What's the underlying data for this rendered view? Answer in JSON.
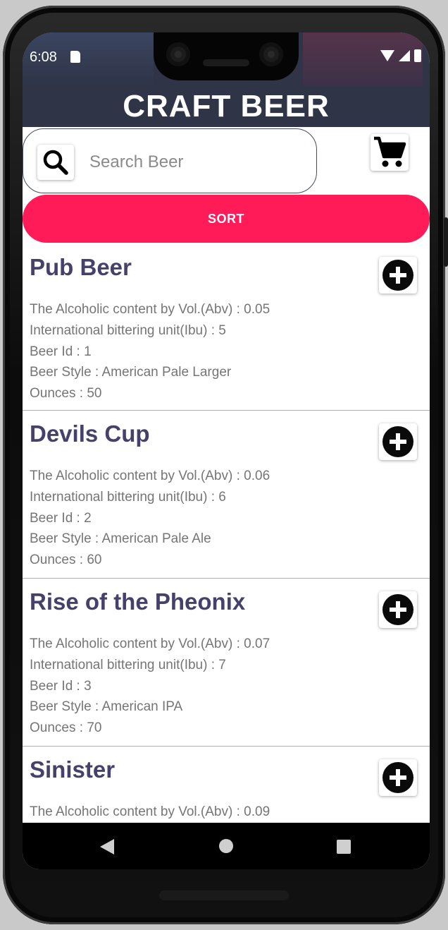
{
  "status": {
    "time": "6:08"
  },
  "app": {
    "title": "CRAFT BEER"
  },
  "search": {
    "placeholder": "Search Beer"
  },
  "sort": {
    "label": "SORT"
  },
  "labels": {
    "abv": "The Alcoholic content by Vol.(Abv) : ",
    "ibu": "International bittering unit(Ibu) : ",
    "id": "Beer Id : ",
    "style": "Beer Style : ",
    "ounces": "Ounces : "
  },
  "beers": [
    {
      "name": "Pub Beer",
      "abv": "0.05",
      "ibu": "5",
      "id": "1",
      "style": "American Pale Larger",
      "ounces": "50"
    },
    {
      "name": "Devils Cup",
      "abv": "0.06",
      "ibu": "6",
      "id": "2",
      "style": "American Pale Ale",
      "ounces": "60"
    },
    {
      "name": "Rise of the Pheonix",
      "abv": "0.07",
      "ibu": "7",
      "id": "3",
      "style": "American IPA",
      "ounces": "70"
    },
    {
      "name": "Sinister",
      "abv": "0.09"
    }
  ],
  "colors": {
    "appbar": "#2f3447",
    "sort_button": "#ff1a58",
    "divider": "#f0a81c",
    "title": "#46416a"
  },
  "icons": {
    "search": "search-icon",
    "cart": "shopping-cart-icon",
    "add": "add-circle-icon"
  }
}
